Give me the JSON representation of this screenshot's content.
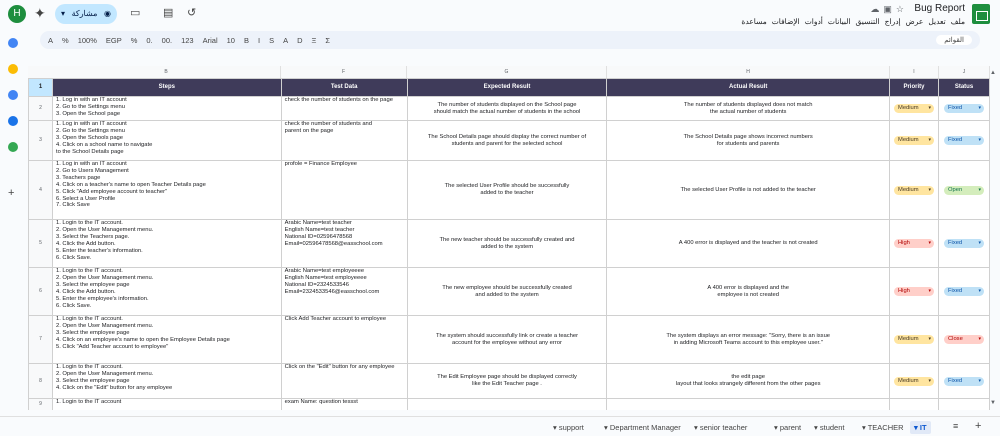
{
  "app": {
    "title": "Bug Report",
    "avatar_letter": "H",
    "share_label": "مشاركة"
  },
  "menu": [
    "ملف",
    "تعديل",
    "عرض",
    "إدراج",
    "التنسيق",
    "البيانات",
    "أدوات",
    "الإضافات",
    "مساعدة"
  ],
  "toolbar": {
    "items": [
      "A",
      "%",
      "100%",
      "EGP",
      "%",
      "0.",
      "00.",
      "123",
      "Arial",
      "10",
      "B",
      "I",
      "S",
      "A",
      "D",
      "Ξ",
      "Σ"
    ],
    "search_label": "القوائم"
  },
  "columns": [
    "B",
    "F",
    "G",
    "H",
    "I",
    "J"
  ],
  "headers": {
    "row": "1",
    "steps": "Steps",
    "test_data": "Test Data",
    "expected": "Expected Result",
    "actual": "Actual Result",
    "priority": "Priority",
    "status": "Status"
  },
  "rows": [
    {
      "n": "2",
      "steps": "1. Log in with an IT account\n2. Go to the Settings menu\n3. Open the School page",
      "data": "check the number of students on the page",
      "expected": "The number of students displayed on the School page\nshould match the actual number of students in the school",
      "actual": "The number of students displayed does not match\nthe actual number of students",
      "priority": "Medium",
      "status": "Fixed"
    },
    {
      "n": "3",
      "steps": "1. Log in with an IT account\n2. Go to the Settings menu\n3. Open the Schools page\n4. Click on a school name to navigate\nto the School Details page",
      "data": "check the number of students and\nparent on the page",
      "expected": "The School Details page should display the correct number of\nstudents and parent for the selected school",
      "actual": "The School Details page shows incorrect numbers\nfor students and parents",
      "priority": "Medium",
      "status": "Fixed"
    },
    {
      "n": "4",
      "steps": "1. Log in with an IT account\n2. Go to Users Management\n3. Teachers page\n4. Click on a teacher's name to open Teacher Details page\n5. Click \"Add employee account to teacher\"\n6. Select a User Profile\n7. Click Save",
      "data": "profole = Finance Employee",
      "expected": "The selected User Profile should be successfully\nadded to the teacher",
      "actual": "The selected User Profile is not added to the teacher",
      "priority": "Medium",
      "status": "Open"
    },
    {
      "n": "5",
      "steps": "1. Login to the IT account.\n2. Open the User Management menu.\n3. Select the Teachers page.\n4. Click the Add button.\n5. Enter the teacher's information.\n6. Click Save.",
      "data": "Arabic Name=test teacher\nEnglish Name=test teacher\nNational ID=02596478568\nEmail=02596478568@easschool.com",
      "expected": "The new teacher should be successfully created and\nadded to the system",
      "actual": "A 400 error is displayed and the teacher is not created",
      "priority": "High",
      "status": "Fixed"
    },
    {
      "n": "6",
      "steps": "1. Login to the IT account.\n2. Open the User Management menu.\n3. Select the employee page\n4. Click the Add button.\n5. Enter the employee's information.\n6. Click Save.",
      "data": "Arabic Name=test employeeee\nEnglish Name=test employeeee\nNational ID=2324533546\nEmail=2324533546@easschool.com",
      "expected": "The new employee should be successfully created\nand added to the system",
      "actual": "A 400 error is displayed and the\nemployee is not created",
      "priority": "High",
      "status": "Fixed"
    },
    {
      "n": "7",
      "steps": "1. Login to the IT account.\n2. Open the User Management menu.\n3. Select the employee page\n4. Click on an employee's name to open the Employee Details page\n5. Click \"Add Teacher account to employee\"",
      "data": "Click Add Teacher account to employee",
      "expected": "The system should successfully link or create a teacher\naccount for the employee without any error",
      "actual": "The system displays an error message: \"Sorry, there is an issue\nin adding Microsoft Teams account to this employee user.\"",
      "priority": "Medium",
      "status": "Close"
    },
    {
      "n": "8",
      "steps": "1. Login to the IT account.\n2. Open the User Management menu.\n3. Select the employee page\n4. Click on the \"Edit\" button for any employee",
      "data": "Click on the \"Edit\" button for any employee",
      "expected": "The Edit Employee page should be displayed correctly\nlike the Edit Teacher page .",
      "actual": "the edit page\nlayout that looks strangely different from the other pages",
      "priority": "Medium",
      "status": "Fixed"
    },
    {
      "n": "9",
      "steps": "1. Login to the IT account",
      "data": "exam Name: question tessst",
      "expected": "",
      "actual": "",
      "priority": "",
      "status": ""
    }
  ],
  "tabs": [
    "support",
    "Department Manager",
    "senior teacher",
    "parent",
    "student",
    "TEACHER",
    "IT"
  ],
  "active_tab": "IT",
  "colors": {
    "header_bg": "#3f3b5a",
    "medium_bg": "#ffe5a0",
    "medium_fg": "#473821",
    "high_bg": "#ffcfc9",
    "high_fg": "#b10202",
    "fixed_bg": "#bfe1f6",
    "fixed_fg": "#0a53a8",
    "open_bg": "#d4edbc",
    "open_fg": "#11734b",
    "close_bg": "#ffcfc9",
    "close_fg": "#b10202"
  }
}
